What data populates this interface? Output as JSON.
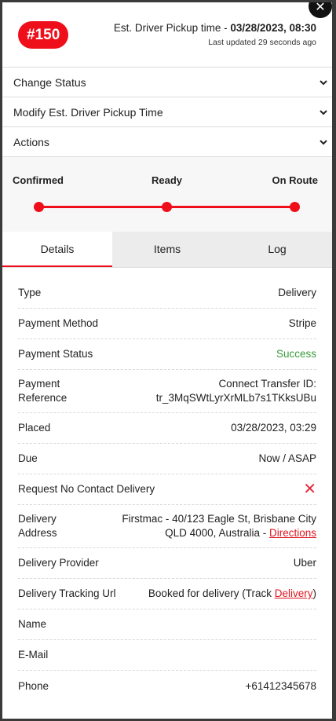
{
  "order": {
    "badge": "#150",
    "pickup_prefix": "Est. Driver Pickup time - ",
    "pickup_time": "03/28/2023, 08:30",
    "last_updated": "Last updated 29 seconds ago"
  },
  "dropdowns": [
    {
      "label": "Change Status"
    },
    {
      "label": "Modify Est. Driver Pickup Time"
    },
    {
      "label": "Actions"
    }
  ],
  "progress": {
    "steps": [
      "Confirmed",
      "Ready",
      "On Route"
    ]
  },
  "tabs": [
    {
      "label": "Details",
      "active": true
    },
    {
      "label": "Items",
      "active": false
    },
    {
      "label": "Log",
      "active": false
    }
  ],
  "details": {
    "type": {
      "label": "Type",
      "value": "Delivery"
    },
    "payment_method": {
      "label": "Payment Method",
      "value": "Stripe"
    },
    "payment_status": {
      "label": "Payment Status",
      "value": "Success"
    },
    "payment_reference": {
      "label_1": "Payment",
      "label_2": "Reference",
      "value_1": "Connect Transfer ID:",
      "value_2": "tr_3MqSWtLyrXrMLb7s1TKksUBu"
    },
    "placed": {
      "label": "Placed",
      "value": "03/28/2023, 03:29"
    },
    "due": {
      "label": "Due",
      "value": "Now / ASAP"
    },
    "no_contact": {
      "label": "Request No Contact Delivery",
      "icon": "x-icon"
    },
    "delivery_address": {
      "label_1": "Delivery",
      "label_2": "Address",
      "value_1": "Firstmac - 40/123 Eagle St, Brisbane City",
      "value_2": "QLD 4000, Australia - ",
      "link": "Directions"
    },
    "delivery_provider": {
      "label": "Delivery Provider",
      "value": "Uber"
    },
    "tracking": {
      "label": "Delivery Tracking Url",
      "prefix": "Booked for delivery (Track ",
      "link": "Delivery",
      "suffix": ")"
    },
    "name": {
      "label": "Name",
      "value": ""
    },
    "email": {
      "label": "E-Mail",
      "value": ""
    },
    "phone": {
      "label": "Phone",
      "value": "+61412345678"
    }
  },
  "colors": {
    "accent": "#ee0f1a",
    "success": "#3b9a3b"
  }
}
